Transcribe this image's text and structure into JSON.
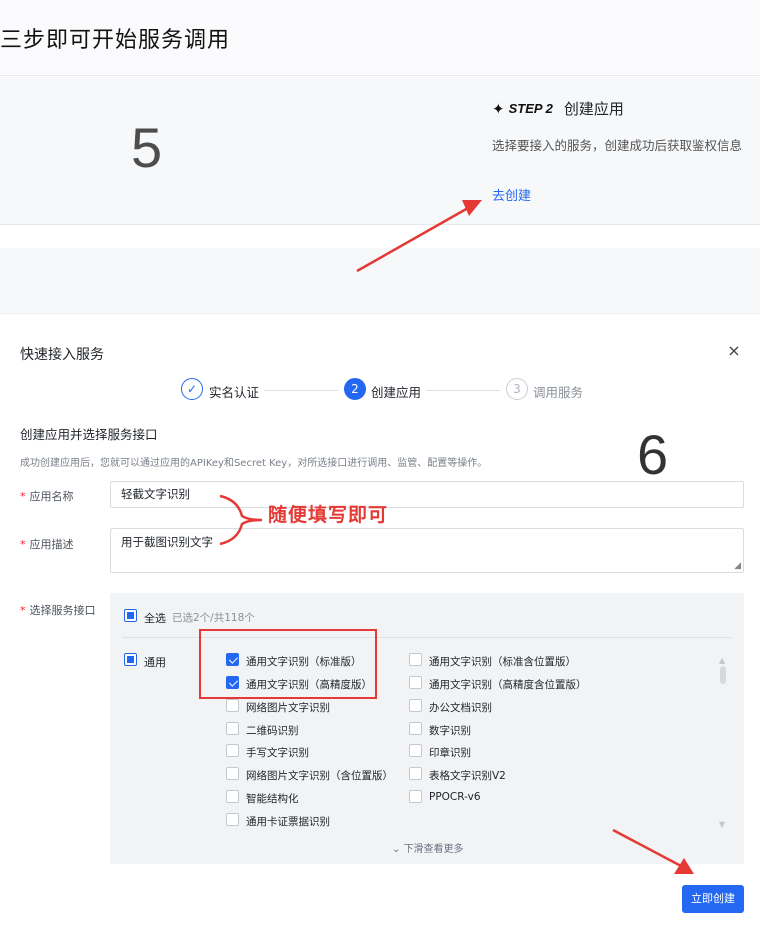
{
  "page": {
    "title": "三步即可开始服务调用",
    "step_number_label": "5",
    "step": {
      "badge": "STEP 2",
      "name": "创建应用",
      "desc": "选择要接入的服务，创建成功后获取鉴权信息",
      "link": "去创建"
    }
  },
  "modal": {
    "title": "快速接入服务",
    "close_glyph": "×",
    "steps": [
      {
        "index": "✓",
        "label": "实名认证",
        "state": "done"
      },
      {
        "index": "2",
        "label": "创建应用",
        "state": "active"
      },
      {
        "index": "3",
        "label": "调用服务",
        "state": "todo"
      }
    ],
    "section_title": "创建应用并选择服务接口",
    "section_desc": "成功创建应用后，您就可以通过应用的APIKey和Secret Key，对所选接口进行调用、监管、配置等操作。",
    "annotation_number": "6",
    "fields": {
      "app_name_label": "应用名称",
      "app_name_value": "轻截文字识别",
      "app_desc_label": "应用描述",
      "app_desc_value": "用于截图识别文字",
      "services_label": "选择服务接口",
      "required_mark": "*"
    },
    "annotation_text": "随便填写即可",
    "services": {
      "select_all_label": "全选",
      "selected_count": "已选2个/共118个",
      "group_label": "通用",
      "left_items": [
        {
          "label": "通用文字识别（标准版）",
          "checked": true
        },
        {
          "label": "通用文字识别（高精度版）",
          "checked": true
        },
        {
          "label": "网络图片文字识别",
          "checked": false
        },
        {
          "label": "二维码识别",
          "checked": false
        },
        {
          "label": "手写文字识别",
          "checked": false
        },
        {
          "label": "网络图片文字识别（含位置版）",
          "checked": false
        },
        {
          "label": "智能结构化",
          "checked": false
        },
        {
          "label": "通用卡证票据识别",
          "checked": false
        }
      ],
      "right_items": [
        {
          "label": "通用文字识别（标准含位置版）",
          "checked": false
        },
        {
          "label": "通用文字识别（高精度含位置版）",
          "checked": false
        },
        {
          "label": "办公文档识别",
          "checked": false
        },
        {
          "label": "数字识别",
          "checked": false
        },
        {
          "label": "印章识别",
          "checked": false
        },
        {
          "label": "表格文字识别V2",
          "checked": false
        },
        {
          "label": "PPOCR-v6",
          "checked": false
        }
      ],
      "more_hint": "下滑查看更多"
    },
    "create_button": "立即创建"
  },
  "colors": {
    "accent": "#2468f2",
    "annotation": "#e53935"
  }
}
